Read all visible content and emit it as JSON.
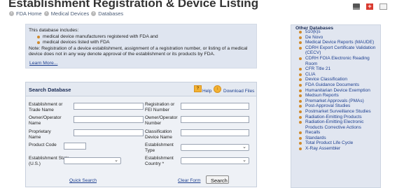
{
  "header": {
    "title": "Establishment Registration & Device Listing",
    "breadcrumb": [
      "FDA Home",
      "Medical Devices",
      "Databases"
    ]
  },
  "toolbar": {
    "icons": [
      "print-icon",
      "plus-icon",
      "email-icon"
    ]
  },
  "info": {
    "intro": "This database includes:",
    "bullets": [
      "medical device manufacturers registered with FDA and",
      "medical devices listed with FDA"
    ],
    "note": "Note: Registration of a device establishment, assignment of a registration number, or listing of a medical device does not in any way denote approval of the establishment or its products by FDA.",
    "learn_more": "Learn More..."
  },
  "search": {
    "title": "Search Database",
    "help": "Help",
    "download": "Download Files",
    "fields": {
      "establishment": "Establishment or Trade Name",
      "registration": "Registration or FEI Number",
      "owner_name": "Owner/Operator Name",
      "owner_number": "Owner/Operator Number",
      "proprietary": "Proprietary Name",
      "classification": "Classification Device Name",
      "product_code": "Product Code",
      "establishment_type": "Establishment Type",
      "state": "Establishment State (U.S.)",
      "country": "Establishment Country *"
    },
    "quick_search": "Quick Search",
    "clear_form": "Clear Form",
    "search_button": "Search"
  },
  "other_databases": {
    "title": "Other Databases",
    "items": [
      "510(k)s",
      "De Novo",
      "Medical Device Reports (MAUDE)",
      "CDRH Export Certificate Validation (CECV)",
      "CDRH FOIA Electronic Reading Room",
      "CFR Title 21",
      "CLIA",
      "Device Classification",
      "FDA Guidance Documents",
      "Humanitarian Device Exemption",
      "Medsun Reports",
      "Premarket Approvals (PMAs)",
      "Post-Approval Studies",
      "Postmarket Surveillance Studies",
      "Radiation-Emitting Products",
      "Radiation-Emitting Electronic Products Corrective Actions",
      "Recalls",
      "Standards",
      "Total Product Life Cycle",
      "X-Ray Assembler"
    ]
  }
}
